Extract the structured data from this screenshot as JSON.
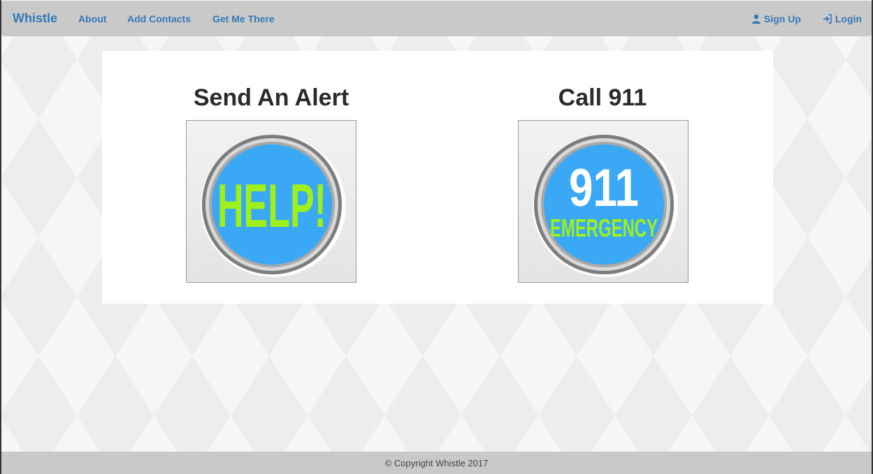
{
  "navbar": {
    "brand": "Whistle",
    "links": [
      "About",
      "Add Contacts",
      "Get Me There"
    ],
    "signup_label": "Sign Up",
    "login_label": "Login"
  },
  "main": {
    "alert_title": "Send An Alert",
    "alert_button_text": "HELP!",
    "call_title": "Call 911",
    "call_button_number": "911",
    "call_button_text": "EMERGENCY"
  },
  "footer": {
    "text": "© Copyright Whistle 2017"
  },
  "colors": {
    "accent": "#3479b7",
    "button_blue": "#3aa8f5",
    "button_green": "#9ef01a",
    "navbar": "#c9c9c9"
  }
}
